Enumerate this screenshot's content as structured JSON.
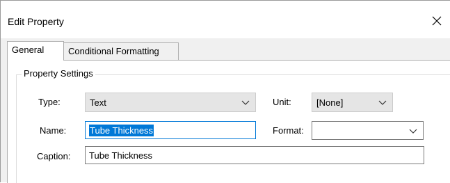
{
  "dialog": {
    "title": "Edit Property"
  },
  "tabs": [
    {
      "label": "General",
      "active": true
    },
    {
      "label": "Conditional Formatting",
      "active": false
    }
  ],
  "group": {
    "legend": "Property Settings"
  },
  "fields": {
    "type_label": "Type:",
    "type_value": "Text",
    "unit_label": "Unit:",
    "unit_value": "[None]",
    "name_label": "Name:",
    "name_value": "Tube Thickness",
    "format_label": "Format:",
    "format_value": "",
    "caption_label": "Caption:",
    "caption_value": "Tube Thickness"
  },
  "colors": {
    "selection": "#0078d7",
    "focus_border": "#0078d7"
  },
  "icons": {
    "close": "close-icon",
    "dropdown": "chevron-down-icon"
  }
}
